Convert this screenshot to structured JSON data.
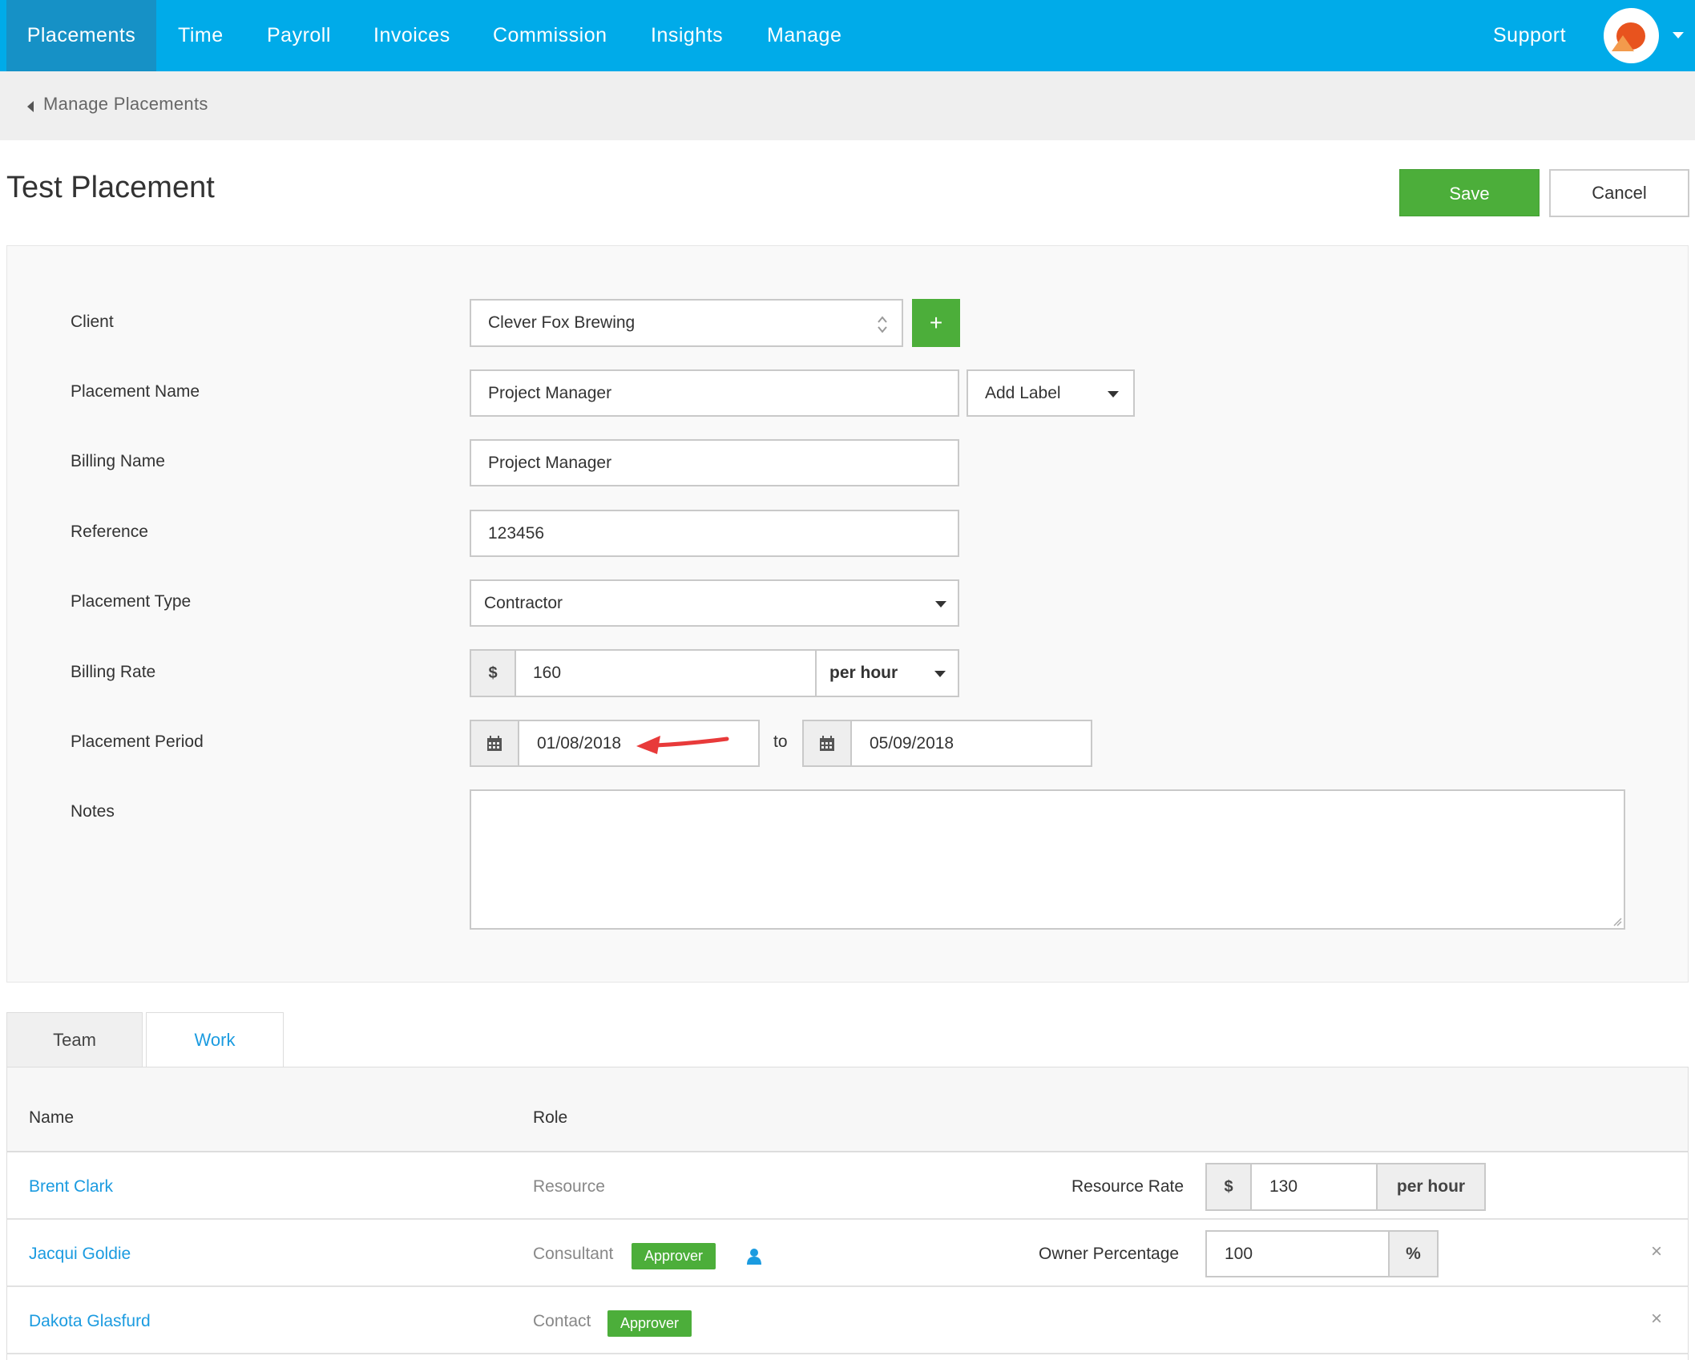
{
  "nav": {
    "items": [
      "Placements",
      "Time",
      "Payroll",
      "Invoices",
      "Commission",
      "Insights",
      "Manage"
    ],
    "support": "Support"
  },
  "breadcrumb": {
    "back_label": "Manage Placements"
  },
  "header": {
    "title": "Test Placement",
    "save_label": "Save",
    "cancel_label": "Cancel"
  },
  "form": {
    "client_label": "Client",
    "client_value": "Clever Fox Brewing",
    "add_client_label": "+",
    "placement_name_label": "Placement Name",
    "placement_name_value": "Project Manager",
    "add_label": "Add Label",
    "billing_name_label": "Billing Name",
    "billing_name_value": "Project Manager",
    "reference_label": "Reference",
    "reference_value": "123456",
    "placement_type_label": "Placement Type",
    "placement_type_value": "Contractor",
    "billing_rate_label": "Billing Rate",
    "currency_symbol": "$",
    "billing_rate_value": "160",
    "rate_unit": "per hour",
    "placement_period_label": "Placement Period",
    "start_date": "01/08/2018",
    "to_label": "to",
    "end_date": "05/09/2018",
    "notes_label": "Notes",
    "notes_value": ""
  },
  "tabs": {
    "team": "Team",
    "work": "Work"
  },
  "team_table": {
    "col_name": "Name",
    "col_role": "Role",
    "rows": [
      {
        "name": "Brent Clark",
        "role": "Resource",
        "field_label": "Resource Rate",
        "prefix": "$",
        "value": "130",
        "suffix": "per hour"
      },
      {
        "name": "Jacqui Goldie",
        "role": "Consultant",
        "badge": "Approver",
        "field_label": "Owner Percentage",
        "value": "100",
        "suffix": "%",
        "remove": "×"
      },
      {
        "name": "Dakota Glasfurd",
        "role": "Contact",
        "badge": "Approver",
        "remove": "×"
      }
    ]
  },
  "colors": {
    "nav": "#00abe9",
    "nav_active": "#1691c6",
    "success": "#4cae3a",
    "link": "#1b9be0",
    "annotation_arrow": "#e83a3a"
  }
}
